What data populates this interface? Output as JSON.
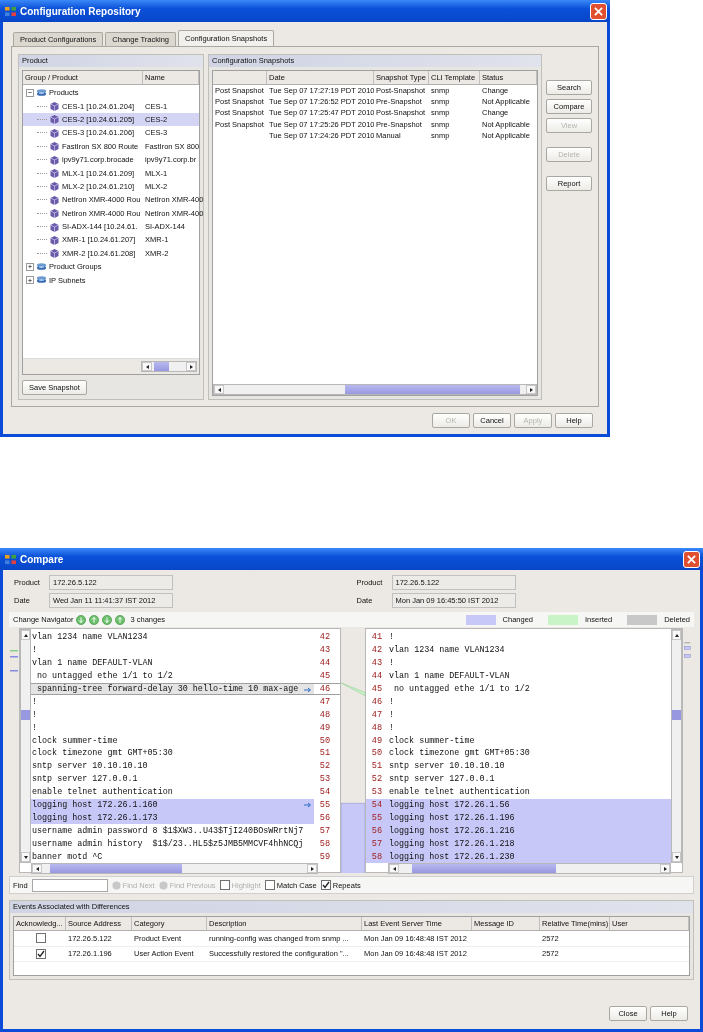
{
  "repository": {
    "window": {
      "title": "Configuration Repository"
    },
    "tabs": [
      {
        "label": "Product Configurations",
        "selected": false
      },
      {
        "label": "Change Tracking",
        "selected": false
      },
      {
        "label": "Configuration Snapshots",
        "selected": true
      }
    ],
    "product_panel": {
      "title": "Product",
      "columns": [
        "Group / Product",
        "Name"
      ],
      "tree": [
        {
          "label": "Products",
          "expanded": true,
          "children": [
            {
              "label": "CES-1 [10.24.61.204]",
              "name": "CES-1",
              "selected": false
            },
            {
              "label": "CES-2 [10.24.61.205]",
              "name": "CES-2",
              "selected": true
            },
            {
              "label": "CES-3 [10.24.61.206]",
              "name": "CES-3",
              "selected": false
            },
            {
              "label": "FastIron SX 800 Route",
              "name": "FastIron SX 800",
              "selected": false
            },
            {
              "label": "ipv9y71.corp.brocade",
              "name": "ipv9y71.corp.br",
              "selected": false
            },
            {
              "label": "MLX-1 [10.24.61.209]",
              "name": "MLX-1",
              "selected": false
            },
            {
              "label": "MLX-2 [10.24.61.210]",
              "name": "MLX-2",
              "selected": false
            },
            {
              "label": "NetIron XMR-4000 Rou",
              "name": "NetIron XMR-400",
              "selected": false
            },
            {
              "label": "NetIron XMR-4000 Rou",
              "name": "NetIron XMR-400",
              "selected": false
            },
            {
              "label": "SI-ADX-144 [10.24.61.",
              "name": "SI-ADX-144",
              "selected": false
            },
            {
              "label": "XMR-1 [10.24.61.207]",
              "name": "XMR-1",
              "selected": false
            },
            {
              "label": "XMR-2 [10.24.61.208]",
              "name": "XMR-2",
              "selected": false
            }
          ]
        },
        {
          "label": "Product Groups",
          "expanded": false
        },
        {
          "label": "IP Subnets",
          "expanded": false
        }
      ],
      "save_button": "Save Snapshot"
    },
    "snapshots_panel": {
      "title": "Configuration Snapshots",
      "columns": [
        "Date",
        "Snapshot Type",
        "CLI Template",
        "Status"
      ],
      "rows": [
        {
          "column_1": "Post Snapshot",
          "date": "Tue Sep 07 17:27:19 PDT 2010",
          "type": "Post-Snapshot",
          "cli_template": "snmp",
          "status": "Change"
        },
        {
          "column_1": "Post Snapshot",
          "date": "Tue Sep 07 17:26:52 PDT 2010",
          "type": "Pre-Snapshot",
          "cli_template": "snmp",
          "status": "Not Applicable"
        },
        {
          "column_1": "Post Snapshot",
          "date": "Tue Sep 07 17:25:47 PDT 2010",
          "type": "Post-Snapshot",
          "cli_template": "snmp",
          "status": "Change"
        },
        {
          "column_1": "Post Snapshot",
          "date": "Tue Sep 07 17:25:26 PDT 2010",
          "type": "Pre-Snapshot",
          "cli_template": "snmp",
          "status": "Not Applicable"
        },
        {
          "date": "Tue Sep 07 17:24:26 PDT 2010",
          "type": "Manual",
          "cli_template": "snmp",
          "status": "Not Applicable"
        }
      ]
    },
    "actions": [
      {
        "label": "Search",
        "disabled": false
      },
      {
        "label": "Compare",
        "disabled": false
      },
      {
        "label": "View",
        "disabled": true
      },
      {
        "label": "Delete",
        "disabled": true
      },
      {
        "label": "Report",
        "disabled": false
      }
    ],
    "buttons": [
      {
        "label": "OK",
        "disabled": true
      },
      {
        "label": "Cancel",
        "disabled": false
      },
      {
        "label": "Apply",
        "disabled": true
      },
      {
        "label": "Help",
        "disabled": false
      }
    ]
  },
  "compare": {
    "window": {
      "title": "Compare"
    },
    "left": {
      "product_label": "Product",
      "product": "172.26.5.122",
      "date_label": "Date",
      "date": "Wed Jan 11 11:41:37 IST 2012"
    },
    "right": {
      "product_label": "Product",
      "product": "172.26.5.122",
      "date_label": "Date",
      "date": "Mon Jan 09 16:45:50 IST 2012"
    },
    "navigator": {
      "label": "Change Navigator",
      "count": "3 changes"
    },
    "legend": [
      {
        "label": "Changed",
        "color": "#c8c8f8"
      },
      {
        "label": "Inserted",
        "color": "#c8f4c8"
      },
      {
        "label": "Deleted",
        "color": "#c8c8c8"
      }
    ],
    "left_lines": [
      {
        "num": "42",
        "text": "vlan 1234 name VLAN1234",
        "kind": "plain",
        "arrow": false
      },
      {
        "num": "43",
        "text": "!",
        "kind": "plain",
        "arrow": false
      },
      {
        "num": "44",
        "text": "vlan 1 name DEFAULT-VLAN",
        "kind": "plain",
        "arrow": false
      },
      {
        "num": "45",
        "text": " no untagged ethe 1/1 to 1/2",
        "kind": "plain",
        "arrow": false
      },
      {
        "num": "46",
        "text": " spanning-tree forward-delay 30 hello-time 10 max-age",
        "kind": "inserted",
        "arrow": true
      },
      {
        "num": "47",
        "text": "!",
        "kind": "plain",
        "arrow": false
      },
      {
        "num": "48",
        "text": "!",
        "kind": "plain",
        "arrow": false
      },
      {
        "num": "49",
        "text": "!",
        "kind": "plain",
        "arrow": false
      },
      {
        "num": "50",
        "text": "clock summer-time",
        "kind": "plain",
        "arrow": false
      },
      {
        "num": "51",
        "text": "clock timezone gmt GMT+05:30",
        "kind": "plain",
        "arrow": false
      },
      {
        "num": "52",
        "text": "sntp server 10.10.10.10",
        "kind": "plain",
        "arrow": false
      },
      {
        "num": "53",
        "text": "sntp server 127.0.0.1",
        "kind": "plain",
        "arrow": false
      },
      {
        "num": "54",
        "text": "enable telnet authentication",
        "kind": "plain",
        "arrow": false
      },
      {
        "num": "55",
        "text": "logging host 172.26.1.160",
        "kind": "changed",
        "arrow": true
      },
      {
        "num": "56",
        "text": "logging host 172.26.1.173",
        "kind": "changed",
        "arrow": false
      },
      {
        "num": "57",
        "text": "username admin password 8 $1$XW3..U43$TjI240BOsWRrtNj7",
        "kind": "plain",
        "arrow": false
      },
      {
        "num": "58",
        "text": "username admin history  $1$/23..HL5$z5JMB5MMCVF4hhNCQj",
        "kind": "plain",
        "arrow": false
      },
      {
        "num": "59",
        "text": "banner motd ^C",
        "kind": "plain",
        "arrow": false
      }
    ],
    "right_lines": [
      {
        "num": "41",
        "text": "!",
        "kind": "plain"
      },
      {
        "num": "42",
        "text": "vlan 1234 name VLAN1234",
        "kind": "plain"
      },
      {
        "num": "43",
        "text": "!",
        "kind": "plain"
      },
      {
        "num": "44",
        "text": "vlan 1 name DEFAULT-VLAN",
        "kind": "plain"
      },
      {
        "num": "45",
        "text": " no untagged ethe 1/1 to 1/2",
        "kind": "plain"
      },
      {
        "num": "46",
        "text": "!",
        "kind": "plain"
      },
      {
        "num": "47",
        "text": "!",
        "kind": "plain"
      },
      {
        "num": "48",
        "text": "!",
        "kind": "plain"
      },
      {
        "num": "49",
        "text": "clock summer-time",
        "kind": "plain"
      },
      {
        "num": "50",
        "text": "clock timezone gmt GMT+05:30",
        "kind": "plain"
      },
      {
        "num": "51",
        "text": "sntp server 10.10.10.10",
        "kind": "plain"
      },
      {
        "num": "52",
        "text": "sntp server 127.0.0.1",
        "kind": "plain"
      },
      {
        "num": "53",
        "text": "enable telnet authentication",
        "kind": "plain"
      },
      {
        "num": "54",
        "text": "logging host 172.26.1.56",
        "kind": "changed"
      },
      {
        "num": "55",
        "text": "logging host 172.26.1.196",
        "kind": "changed"
      },
      {
        "num": "56",
        "text": "logging host 172.26.1.216",
        "kind": "changed"
      },
      {
        "num": "57",
        "text": "logging host 172.26.1.218",
        "kind": "changed"
      },
      {
        "num": "58",
        "text": "logging host 172.26.1.230",
        "kind": "changed"
      }
    ],
    "find": {
      "label": "Find",
      "buttons": [
        {
          "label": "Find Next",
          "disabled": true
        },
        {
          "label": "Find Previous",
          "disabled": true
        }
      ],
      "options": [
        {
          "label": "Highlight",
          "checked": false,
          "disabled": true
        },
        {
          "label": "Match Case",
          "checked": false,
          "disabled": false
        },
        {
          "label": "Repeats",
          "checked": true,
          "disabled": false
        }
      ]
    },
    "events": {
      "title": "Events Associated with Differences",
      "columns": [
        "Acknowledg...",
        "Source Address",
        "Category",
        "Description",
        "Last Event Server Time",
        "Message ID",
        "Relative Time(mins)",
        "User"
      ],
      "rows": [
        {
          "acknowledged": false,
          "source": "172.26.5.122",
          "category": "Product Event",
          "description": "running-config was changed from snmp ...",
          "time": "Mon Jan 09 16:48:48 IST 2012",
          "relative": "2572"
        },
        {
          "acknowledged": true,
          "source": "172.26.1.196",
          "category": "User Action Event",
          "description": "Successfully restored the configuration \"...",
          "time": "Mon Jan 09 16:48:48 IST 2012",
          "relative": "2572"
        }
      ]
    },
    "buttons": [
      "Close",
      "Help"
    ]
  }
}
